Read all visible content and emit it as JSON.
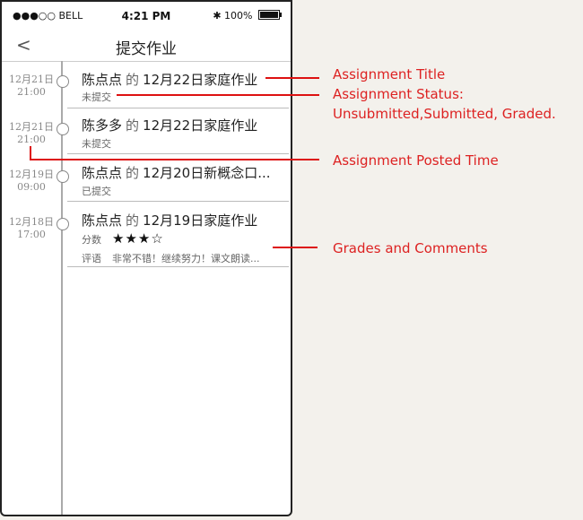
{
  "status_bar": {
    "carrier": "●●●○○ BELL",
    "time": "4:21 PM",
    "battery": "100%"
  },
  "nav": {
    "back_label": "<",
    "title": "提交作业"
  },
  "items": [
    {
      "date": "12月21日",
      "time": "21:00",
      "author": "陈点点",
      "de": "的",
      "assignment": "12月22日家庭作业",
      "status": "未提交"
    },
    {
      "date": "12月21日",
      "time": "21:00",
      "author": "陈多多",
      "de": "的",
      "assignment": "12月22日家庭作业",
      "status": "未提交"
    },
    {
      "date": "12月19日",
      "time": "09:00",
      "author": "陈点点",
      "de": "的",
      "assignment": "12月20日新概念口...",
      "status": "已提交"
    },
    {
      "date": "12月18日",
      "time": "17:00",
      "author": "陈点点",
      "de": "的",
      "assignment": "12月19日家庭作业",
      "score_label": "分数",
      "stars": "★★★☆",
      "rating": 3,
      "rating_max": 4,
      "comment_label": "评语",
      "comment": "非常不错！继续努力！课文朗读..."
    }
  ],
  "annotations": {
    "title": "Assignment Title",
    "status_line1": "Assignment Status:",
    "status_line2": "Unsubmitted,Submitted, Graded.",
    "posted_time": "Assignment Posted Time",
    "grades": "Grades and Comments"
  },
  "colors": {
    "annotation": "#dd1111",
    "background": "#f3f1ec"
  }
}
